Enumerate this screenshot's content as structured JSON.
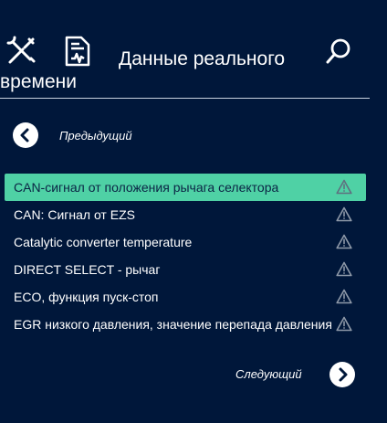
{
  "header": {
    "title_line1": "Данные реального",
    "title_line2": "времени",
    "icons": [
      "tools-icon",
      "document-chart-icon",
      "search-icon"
    ]
  },
  "navigation": {
    "previous_label": "Предыдущий",
    "next_label": "Следующий"
  },
  "list": {
    "items": [
      {
        "label": "CAN-сигнал от положения рычага селектора",
        "selected": true,
        "icon": "warning-icon"
      },
      {
        "label": "CAN: Сигнал от EZS",
        "selected": false,
        "icon": "warning-icon"
      },
      {
        "label": "Catalytic converter temperature",
        "selected": false,
        "icon": "warning-icon"
      },
      {
        "label": "DIRECT SELECT - рычаг",
        "selected": false,
        "icon": "warning-icon"
      },
      {
        "label": "ECO, функция пуск-стоп",
        "selected": false,
        "icon": "warning-icon"
      },
      {
        "label": "EGR низкого давления, значение перепада давления",
        "selected": false,
        "icon": "warning-icon"
      }
    ]
  },
  "colors": {
    "background": "#00173a",
    "selected_row": "#4fd1a5",
    "warning_icon": "#8e99a8",
    "warning_icon_selected": "#5f6f7f"
  }
}
